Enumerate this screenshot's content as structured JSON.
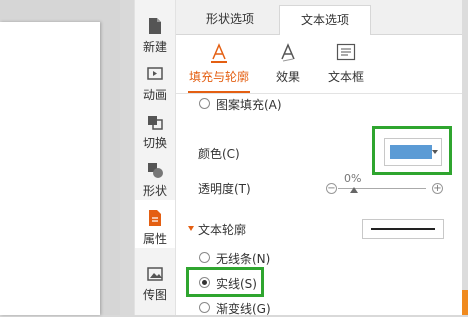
{
  "toolbar": {
    "items": [
      {
        "label": "新建",
        "icon": "new-doc-icon"
      },
      {
        "label": "动画",
        "icon": "animation-icon"
      },
      {
        "label": "切换",
        "icon": "transition-icon"
      },
      {
        "label": "形状",
        "icon": "shape-icon"
      },
      {
        "label": "属性",
        "icon": "properties-icon",
        "active": true
      },
      {
        "label": "传图",
        "icon": "upload-image-icon"
      }
    ]
  },
  "panel": {
    "tabs": [
      {
        "label": "形状选项"
      },
      {
        "label": "文本选项",
        "active": true
      }
    ],
    "subtabs": [
      {
        "label": "填充与轮廓",
        "icon": "text-fill-outline-icon",
        "active": true
      },
      {
        "label": "效果",
        "icon": "text-effect-icon"
      },
      {
        "label": "文本框",
        "icon": "textbox-icon"
      }
    ],
    "fill": {
      "pattern_fill_label": "图案填充(A)",
      "color_label": "颜色(C)",
      "color_value": "#5b9bd5",
      "transparency_label": "透明度(T)",
      "transparency_value": "0%"
    },
    "outline": {
      "section_title": "文本轮廓",
      "options": [
        {
          "label": "无线条(N)",
          "checked": false
        },
        {
          "label": "实线(S)",
          "checked": true
        },
        {
          "label": "渐变线(G)",
          "checked": false
        }
      ]
    }
  },
  "colors": {
    "accent": "#e45f12",
    "highlight": "#2fa52f",
    "swatch": "#5b9bd5"
  }
}
